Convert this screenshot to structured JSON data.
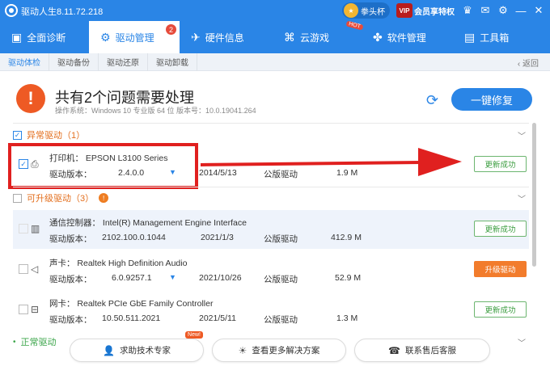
{
  "titlebar": {
    "title": "驱动人生8.11.72.218",
    "badge": "拳头杯",
    "vip": "会员享特权",
    "vip_icon_text": "VIP"
  },
  "nav": [
    {
      "label": "全面诊断",
      "icon": "monitor-icon"
    },
    {
      "label": "驱动管理",
      "icon": "gear-icon",
      "badge": "2"
    },
    {
      "label": "硬件信息",
      "icon": "rocket-icon"
    },
    {
      "label": "云游戏",
      "icon": "gamepad-icon",
      "tag": "HOT"
    },
    {
      "label": "软件管理",
      "icon": "apps-icon"
    },
    {
      "label": "工具箱",
      "icon": "toolbox-icon"
    }
  ],
  "subtabs": [
    "驱动体检",
    "驱动备份",
    "驱动还原",
    "驱动卸载"
  ],
  "back_label": "返回",
  "summary": {
    "title": "共有2个问题需要处理",
    "meta": "操作系统：Windows 10 专业版 64 位    版本号：10.0.19041.264",
    "repair_button": "一键修复"
  },
  "sections": {
    "abnormal": "异常驱动（1）",
    "upgradable": "可升级驱动（3）",
    "normal": "正常驱动"
  },
  "rows": [
    {
      "name": "打印机：  EPSON L3100 Series",
      "version_label": "驱动版本：",
      "version": "2.4.0.0",
      "date": "2014/5/13",
      "publisher": "公版驱动",
      "size": "1.9 M",
      "button": "更新成功",
      "icon": "printer-icon"
    },
    {
      "name": "通信控制器：  Intel(R) Management Engine Interface",
      "version_label": "驱动版本：",
      "version": "2102.100.0.1044",
      "date": "2021/1/3",
      "publisher": "公版驱动",
      "size": "412.9 M",
      "button": "更新成功",
      "icon": "chip-icon"
    },
    {
      "name": "声卡：  Realtek High Definition Audio",
      "version_label": "驱动版本：",
      "version": "6.0.9257.1",
      "date": "2021/10/26",
      "publisher": "公版驱动",
      "size": "52.9 M",
      "button": "升级驱动",
      "icon": "speaker-icon"
    },
    {
      "name": "网卡：  Realtek PCIe GbE Family Controller",
      "version_label": "驱动版本：",
      "version": "10.50.511.2021",
      "date": "2021/5/11",
      "publisher": "公版驱动",
      "size": "1.3 M",
      "button": "更新成功",
      "icon": "network-icon"
    }
  ],
  "footer": {
    "help": "求助技术专家",
    "help_tag": "New!",
    "solutions": "查看更多解决方案",
    "support": "联系售后客服"
  }
}
